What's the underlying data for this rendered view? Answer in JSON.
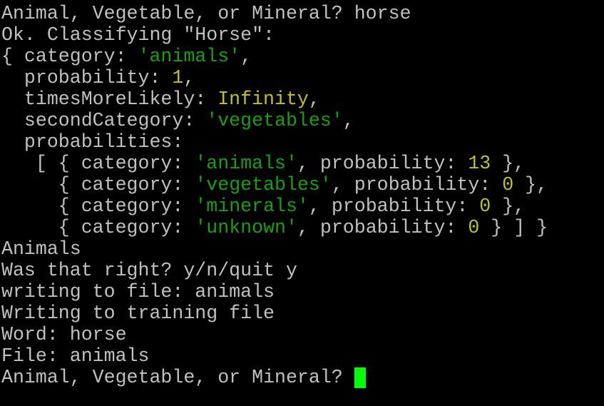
{
  "terminal": {
    "lines": [
      [
        {
          "t": "Animal, Vegetable, or Mineral? horse",
          "c": ""
        }
      ],
      [
        {
          "t": "Ok. Classifying \"Horse\":",
          "c": ""
        }
      ],
      [
        {
          "t": "{ category: ",
          "c": ""
        },
        {
          "t": "'animals'",
          "c": "str"
        },
        {
          "t": ",",
          "c": ""
        }
      ],
      [
        {
          "t": "  probability: ",
          "c": ""
        },
        {
          "t": "1",
          "c": "num"
        },
        {
          "t": ",",
          "c": ""
        }
      ],
      [
        {
          "t": "  timesMoreLikely: ",
          "c": ""
        },
        {
          "t": "Infinity",
          "c": "num"
        },
        {
          "t": ",",
          "c": ""
        }
      ],
      [
        {
          "t": "  secondCategory: ",
          "c": ""
        },
        {
          "t": "'vegetables'",
          "c": "str"
        },
        {
          "t": ",",
          "c": ""
        }
      ],
      [
        {
          "t": "  probabilities:",
          "c": ""
        }
      ],
      [
        {
          "t": "   [ { category: ",
          "c": ""
        },
        {
          "t": "'animals'",
          "c": "str"
        },
        {
          "t": ", probability: ",
          "c": ""
        },
        {
          "t": "13",
          "c": "num"
        },
        {
          "t": " },",
          "c": ""
        }
      ],
      [
        {
          "t": "     { category: ",
          "c": ""
        },
        {
          "t": "'vegetables'",
          "c": "str"
        },
        {
          "t": ", probability: ",
          "c": ""
        },
        {
          "t": "0",
          "c": "num"
        },
        {
          "t": " },",
          "c": ""
        }
      ],
      [
        {
          "t": "     { category: ",
          "c": ""
        },
        {
          "t": "'minerals'",
          "c": "str"
        },
        {
          "t": ", probability: ",
          "c": ""
        },
        {
          "t": "0",
          "c": "num"
        },
        {
          "t": " },",
          "c": ""
        }
      ],
      [
        {
          "t": "     { category: ",
          "c": ""
        },
        {
          "t": "'unknown'",
          "c": "str"
        },
        {
          "t": ", probability: ",
          "c": ""
        },
        {
          "t": "0",
          "c": "num"
        },
        {
          "t": " } ] }",
          "c": ""
        }
      ],
      [
        {
          "t": "Animals",
          "c": ""
        }
      ],
      [
        {
          "t": "Was that right? y/n/quit y",
          "c": ""
        }
      ],
      [
        {
          "t": "writing to file: animals",
          "c": ""
        }
      ],
      [
        {
          "t": "Writing to training file",
          "c": ""
        }
      ],
      [
        {
          "t": "Word: horse",
          "c": ""
        }
      ],
      [
        {
          "t": "File: animals",
          "c": ""
        }
      ]
    ],
    "prompt": "Animal, Vegetable, or Mineral? ",
    "colors": {
      "text": "#c0c0c0",
      "string": "#13a10e",
      "number": "#c1c11a",
      "cursor": "#00ff00",
      "background": "#000000"
    }
  }
}
